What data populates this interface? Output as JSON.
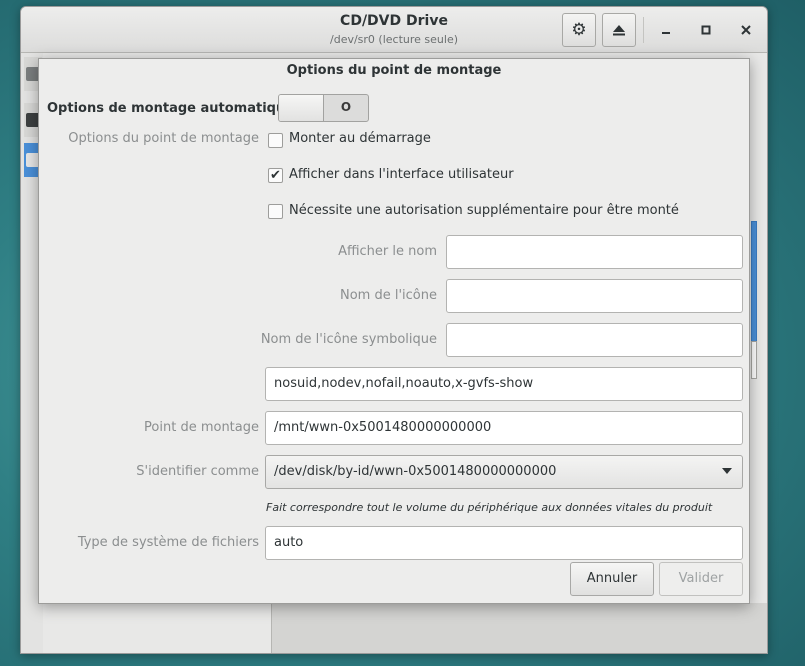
{
  "main_window": {
    "title": "CD/DVD Drive",
    "subtitle": "/dev/sr0 (lecture seule)",
    "settings_icon": "gear-icon",
    "eject_icon": "eject-icon",
    "minimize_glyph": "−",
    "maximize_glyph": "□",
    "close_glyph": "×"
  },
  "dialog": {
    "title": "Options du point de montage",
    "auto_mount": {
      "label": "Options de montage automatique",
      "toggle_text": "O",
      "state": "off"
    },
    "mount_options_label": "Options du point de montage",
    "checkboxes": [
      {
        "label": "Monter au démarrage",
        "checked": false
      },
      {
        "label": "Afficher dans l'interface utilisateur",
        "checked": true
      },
      {
        "label": "Nécessite une autorisation supplémentaire pour être monté",
        "checked": false
      }
    ],
    "display_name": {
      "label": "Afficher le nom",
      "value": ""
    },
    "icon_name": {
      "label": "Nom de l'icône",
      "value": ""
    },
    "symbolic_icon_name": {
      "label": "Nom de l'icône symbolique",
      "value": ""
    },
    "options_value": "nosuid,nodev,nofail,noauto,x-gvfs-show",
    "mount_point": {
      "label": "Point de montage",
      "value": "/mnt/wwn-0x5001480000000000"
    },
    "identify_as": {
      "label": "S'identifier comme",
      "value": "/dev/disk/by-id/wwn-0x5001480000000000",
      "hint": "Fait correspondre tout le volume du périphérique aux données vitales du produit"
    },
    "fs_type": {
      "label": "Type de système de fichiers",
      "value": "auto"
    },
    "cancel_label": "Annuler",
    "ok_label": "Valider"
  },
  "colors": {
    "accent": "#4a90d9",
    "dialog_bg": "#ededec",
    "dim_label": "#8b8e8f"
  }
}
